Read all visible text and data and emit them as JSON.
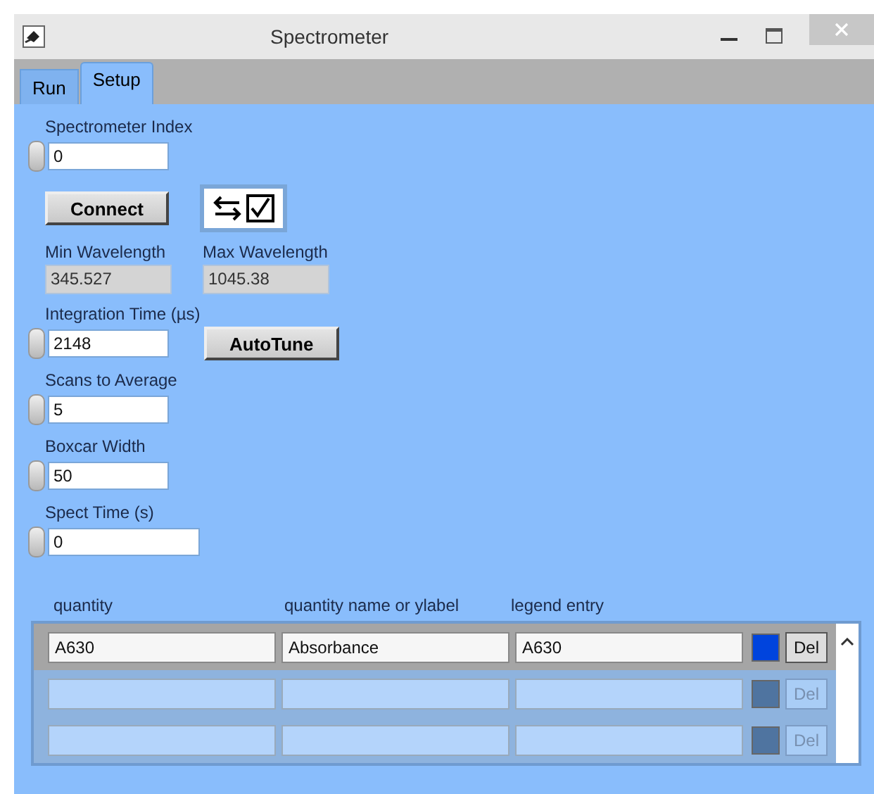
{
  "window": {
    "title": "Spectrometer"
  },
  "tabs": [
    {
      "label": "Run",
      "selected": false
    },
    {
      "label": "Setup",
      "selected": true
    }
  ],
  "spectrometer_index": {
    "label": "Spectrometer Index",
    "value": "0"
  },
  "connect_button": "Connect",
  "connect_toggle": {
    "checked": true
  },
  "wavelengths": [
    {
      "label": "Min Wavelength",
      "value": "345.527"
    },
    {
      "label": "Max Wavelength",
      "value": "1045.38"
    }
  ],
  "integration_time": {
    "label": "Integration Time (µs)",
    "value": "2148"
  },
  "autotune_button": "AutoTune",
  "settings": [
    {
      "label": "Scans to Average",
      "value": "5"
    },
    {
      "label": "Boxcar Width",
      "value": "50"
    },
    {
      "label": "Spect Time (s)",
      "value": "0"
    }
  ],
  "table": {
    "columns": [
      "quantity",
      "quantity name or ylabel",
      "legend entry"
    ],
    "rows": [
      {
        "cells": [
          "A630",
          "Absorbance",
          "A630"
        ],
        "color": "#0044dd",
        "disabled": false,
        "button": "Del"
      },
      {
        "cells": [],
        "color": "#4f74a0",
        "disabled": true,
        "button": "Del"
      },
      {
        "cells": [],
        "color": "#4f74a0",
        "disabled": true,
        "button": "Del"
      }
    ]
  }
}
